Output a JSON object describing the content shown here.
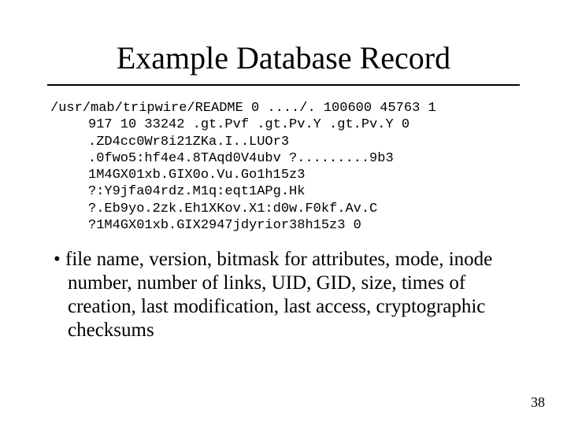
{
  "title": "Example Database Record",
  "code": {
    "l0": "/usr/mab/tripwire/README 0 ..../. 100600 45763 1",
    "l1": "917 10 33242 .gt.Pvf .gt.Pv.Y .gt.Pv.Y 0",
    "l2": ".ZD4cc0Wr8i21ZKa.I..LUOr3",
    "l3": ".0fwo5:hf4e4.8TAqd0V4ubv ?.........9b3",
    "l4": "1M4GX01xb.GIX0o.Vu.Go1h15z3",
    "l5": "?:Y9jfa04rdz.M1q:eqt1APg.Hk",
    "l6": "?.Eb9yo.2zk.Eh1XKov.X1:d0w.F0kf.Av.C",
    "l7": "?1M4GX01xb.GIX2947jdyrior38h15z3 0"
  },
  "bullet": "file name, version, bitmask for attributes, mode, inode number, number of links, UID, GID, size, times of creation, last modification, last access, cryptographic checksums",
  "page": "38"
}
